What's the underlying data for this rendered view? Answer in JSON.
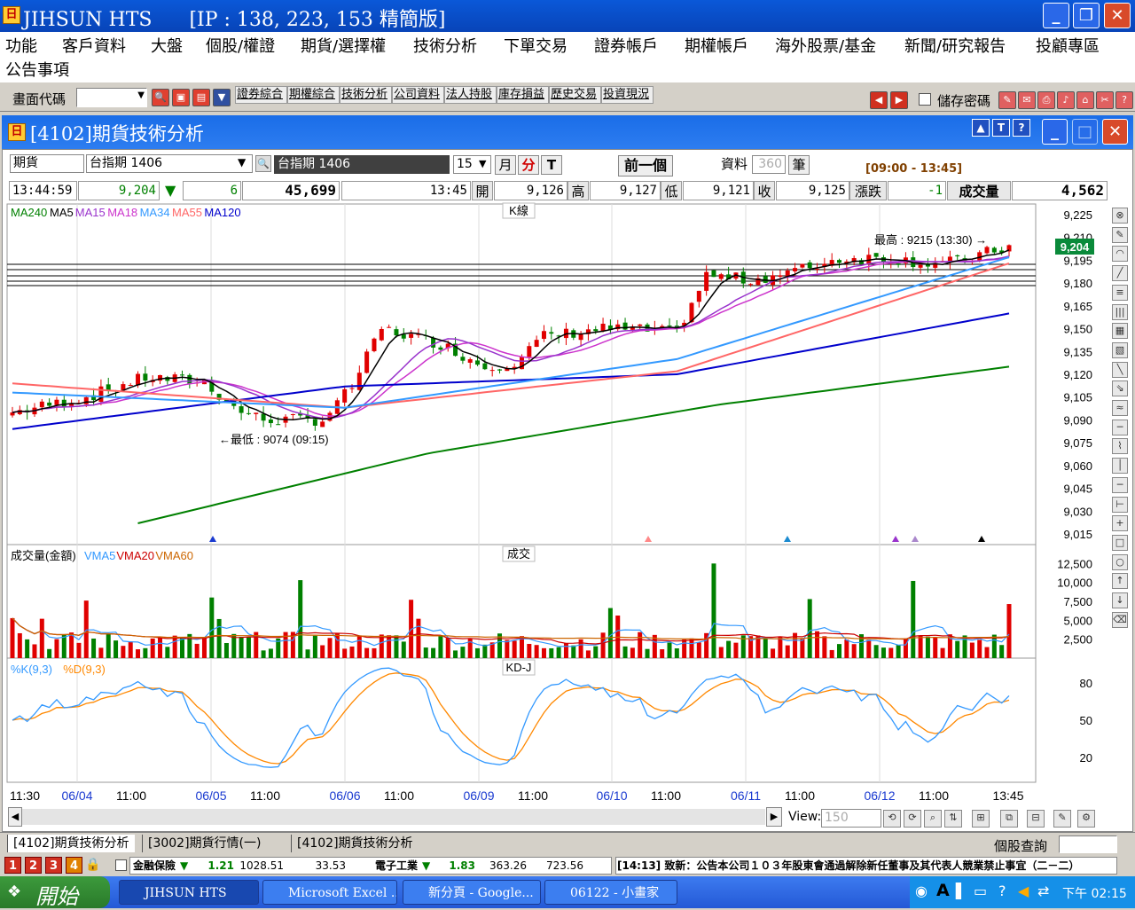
{
  "app": {
    "title": "JIHSUN HTS      [IP : 138, 223, 153 精簡版]",
    "icon_text": "日"
  },
  "menu": {
    "row1": [
      "功能",
      "客戶資料",
      "大盤",
      "個股/權證",
      "期貨/選擇權",
      "技術分析",
      "下單交易",
      "證券帳戶",
      "期權帳戶",
      "海外股票/基金",
      "新聞/研究報告",
      "投顧專區"
    ],
    "row2": [
      "公告事項"
    ]
  },
  "toolbar": {
    "code_label": "畫面代碼",
    "links": [
      "證券綜合",
      "期權綜合",
      "技術分析",
      "公司資料",
      "法人持股",
      "庫存損益",
      "歷史交易",
      "投資現況"
    ],
    "save_pwd": "儲存密碼"
  },
  "window": {
    "title": "[4102]期貨技術分析",
    "icon_text": "日"
  },
  "controls": {
    "market": "期貨",
    "symbol": "台指期 1406",
    "symbol_name": "台指期  1406",
    "interval": "15",
    "btn_month": "月",
    "btn_min": "分",
    "btn_t": "T",
    "prev": "前一個",
    "data_label": "資料",
    "data_count": "360",
    "unit": "筆",
    "session": "[09:00 - 13:45]"
  },
  "quote": {
    "time": "13:44:59",
    "last": "9,204",
    "arrow": "▼",
    "change": "6",
    "volume": "45,699",
    "bar_time": "13:45",
    "open_l": "開",
    "open": "9,126",
    "high_l": "高",
    "high": "9,127",
    "low_l": "低",
    "low": "9,121",
    "close_l": "收",
    "close": "9,125",
    "chg_l": "漲跌",
    "chg": "-1",
    "vol_l": "成交量",
    "vol": "4,562"
  },
  "legend": {
    "ma": [
      {
        "t": "MA240",
        "c": "#008000"
      },
      {
        "t": "MA5",
        "c": "#000000"
      },
      {
        "t": "MA15",
        "c": "#9933cc"
      },
      {
        "t": "MA18",
        "c": "#cc33cc"
      },
      {
        "t": "MA34",
        "c": "#3399ff"
      },
      {
        "t": "MA55",
        "c": "#ff6666"
      },
      {
        "t": "MA120",
        "c": "#0000cc"
      }
    ],
    "vol": [
      {
        "t": "成交量(金額)",
        "c": "#000000"
      },
      {
        "t": "VMA5",
        "c": "#3399ff"
      },
      {
        "t": "VMA20",
        "c": "#cc0000"
      },
      {
        "t": "VMA60",
        "c": "#cc6600"
      }
    ],
    "kd": [
      {
        "t": "%K(9,3)",
        "c": "#3399ff"
      },
      {
        "t": "%D(9,3)",
        "c": "#ff8800"
      }
    ]
  },
  "panel_titles": {
    "price": "K線",
    "volume": "成交",
    "kd": "KD-J"
  },
  "annotations": {
    "high": "最高 : 9215 (13:30) →",
    "low": "←最低 : 9074 (09:15)",
    "last_tag": "9,204"
  },
  "chart_data": [
    {
      "type": "candlestick",
      "title": "K線",
      "y_ticks": [
        "9,225",
        "9,210",
        "9,195",
        "9,180",
        "9,165",
        "9,150",
        "9,135",
        "9,120",
        "9,105",
        "9,090",
        "9,075",
        "9,060",
        "9,045",
        "9,030",
        "9,015"
      ],
      "ylim": [
        9008,
        9232
      ],
      "x_labels": [
        "11:30",
        "06/04",
        "11:00",
        "06/05",
        "11:00",
        "06/06",
        "11:00",
        "06/09",
        "11:00",
        "06/10",
        "11:00",
        "06/11",
        "11:00",
        "06/12",
        "11:00",
        "13:45"
      ],
      "high": {
        "value": 9215,
        "time": "13:30"
      },
      "low": {
        "value": 9074,
        "time": "09:15"
      },
      "last": 9204,
      "series": [
        {
          "name": "MA240",
          "color": "#008000",
          "values": [
            9022,
            9068,
            9100,
            9125
          ]
        },
        {
          "name": "MA120",
          "color": "#0000cc",
          "values": [
            9084,
            9112,
            9120,
            9160
          ]
        },
        {
          "name": "MA55",
          "color": "#ff6666",
          "values": [
            9114,
            9098,
            9122,
            9193
          ]
        },
        {
          "name": "MA34",
          "color": "#3399ff",
          "values": [
            9108,
            9098,
            9130,
            9197
          ]
        },
        {
          "name": "MA5",
          "color": "#000000",
          "values": [
            9096,
            9110,
            9150,
            9204
          ]
        }
      ]
    },
    {
      "type": "bar",
      "title": "成交",
      "y_ticks": [
        "12,500",
        "10,000",
        "7,500",
        "5,000",
        "2,500"
      ],
      "ylim": [
        0,
        15000
      ]
    },
    {
      "type": "line",
      "title": "KD-J",
      "y_ticks": [
        "80",
        "50",
        "20"
      ],
      "ylim": [
        0,
        100
      ]
    }
  ],
  "rightbar": {
    "view_label": "View:",
    "view_value": "150"
  },
  "tabs": [
    "[4102]期貨技術分析",
    "[3002]期貨行情(一)",
    "[4102]期貨技術分析"
  ],
  "tabs_right": "個股查詢",
  "ticker": {
    "pages": [
      "1",
      "2",
      "3",
      "4"
    ],
    "cat1": "金融保險",
    "cat1_arrow": "▼",
    "cat1_chg": "1.21",
    "cat1_idx": "1028.51",
    "cat1_vol": "33.53",
    "cat2": "電子工業",
    "cat2_arrow": "▼",
    "cat2_chg": "1.83",
    "cat2_idx": "363.26",
    "cat2_vol": "723.56",
    "news": "[14:13]  致新：公告本公司１０３年股東會通過解除新任董事及其代表人競業禁止事宜（二－二）"
  },
  "taskbar": {
    "start": "開始",
    "tasks": [
      "JIHSUN HTS",
      "Microsoft Excel ...",
      "新分頁 - Google...",
      "06122 - 小畫家"
    ],
    "clock": "下午 02:15"
  }
}
